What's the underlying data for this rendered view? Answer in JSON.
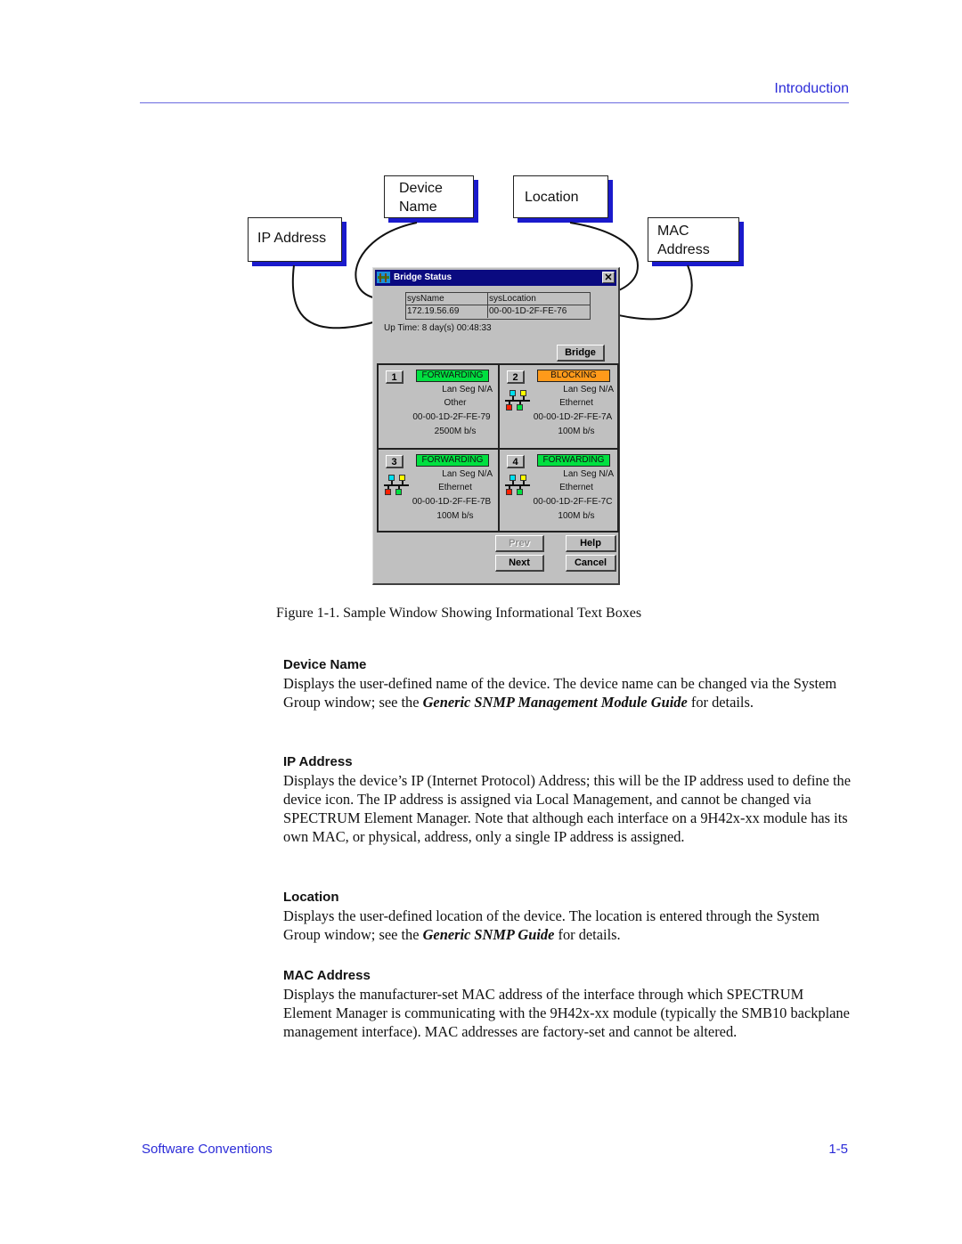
{
  "header": {
    "running_title": "Introduction"
  },
  "figure": {
    "callouts": {
      "device_name": [
        "Device",
        "Name"
      ],
      "location": "Location",
      "ip_address": "IP Address",
      "mac_address": [
        "MAC",
        "Address"
      ]
    },
    "window": {
      "title": "Bridge Status",
      "close_glyph": "✕",
      "sys_table": {
        "headers": [
          "sysName",
          "sysLocation"
        ],
        "values": [
          "172.19.56.69",
          "00-00-1D-2F-FE-76"
        ]
      },
      "uptime": "Up Time: 8 day(s) 00:48:33",
      "bridge_button": "Bridge",
      "ports": [
        {
          "number": "1",
          "status": "FORWARDING",
          "status_color": "#00e040",
          "lan_seg": "Lan Seg N/A",
          "type": "Other",
          "mac": "00-00-1D-2F-FE-79",
          "speed": "2500M b/s",
          "has_icon": false
        },
        {
          "number": "2",
          "status": "BLOCKING",
          "status_color": "#ff9a1a",
          "lan_seg": "Lan Seg N/A",
          "type": "Ethernet",
          "mac": "00-00-1D-2F-FE-7A",
          "speed": "100M b/s",
          "has_icon": true
        },
        {
          "number": "3",
          "status": "FORWARDING",
          "status_color": "#00e040",
          "lan_seg": "Lan Seg N/A",
          "type": "Ethernet",
          "mac": "00-00-1D-2F-FE-7B",
          "speed": "100M b/s",
          "has_icon": true
        },
        {
          "number": "4",
          "status": "FORWARDING",
          "status_color": "#00e040",
          "lan_seg": "Lan Seg N/A",
          "type": "Ethernet",
          "mac": "00-00-1D-2F-FE-7C",
          "speed": "100M b/s",
          "has_icon": true
        }
      ],
      "buttons": {
        "prev": "Prev",
        "next": "Next",
        "help": "Help",
        "cancel": "Cancel"
      },
      "icon_colors": {
        "cyan": "#00e0f0",
        "yellow": "#ffff00",
        "red": "#ff2000",
        "green": "#00e040"
      }
    },
    "caption": "Figure 1-1.  Sample Window Showing Informational Text Boxes"
  },
  "sections": [
    {
      "heading": "Device Name",
      "text_before": "Displays the user-defined name of the device. The device name can be changed via the System Group window; see the ",
      "emphasis": "Generic SNMP Management Module Guide",
      "text_after": " for details."
    },
    {
      "heading": "IP Address",
      "text": "Displays the device’s IP (Internet Protocol) Address; this will be the IP address used to define the device icon. The IP address is assigned via Local Management, and cannot be changed via SPECTRUM Element Manager. Note that although each interface on a 9H42x-xx module has its own MAC, or physical, address, only a single IP address is assigned."
    },
    {
      "heading": "Location",
      "text_before": "Displays the user-defined location of the device. The location is entered through the System Group window; see the ",
      "emphasis": "Generic SNMP Guide",
      "text_after": " for details."
    },
    {
      "heading": "MAC Address",
      "text": "Displays the manufacturer-set MAC address of the interface through which SPECTRUM Element Manager is communicating with the 9H42x-xx module (typically the SMB10 backplane management interface). MAC addresses are factory-set and cannot be altered."
    }
  ],
  "footer": {
    "section_title": "Software Conventions",
    "page_number": "1-5"
  }
}
